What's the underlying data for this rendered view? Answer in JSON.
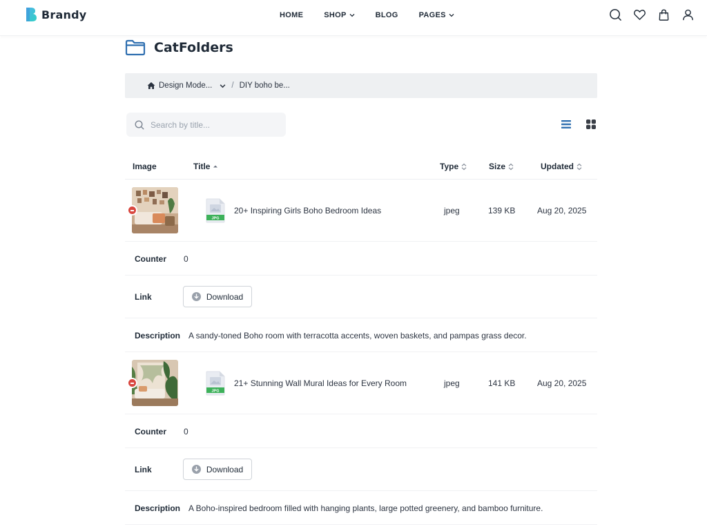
{
  "brand": {
    "name": "Brandy"
  },
  "nav": {
    "items": [
      {
        "label": "HOME",
        "has_dropdown": false
      },
      {
        "label": "SHOP",
        "has_dropdown": true
      },
      {
        "label": "BLOG",
        "has_dropdown": false
      },
      {
        "label": "PAGES",
        "has_dropdown": true
      }
    ]
  },
  "header_icons": [
    "search-icon",
    "heart-icon",
    "bag-icon",
    "user-icon"
  ],
  "page": {
    "title": "CatFolders"
  },
  "breadcrumb": {
    "items": [
      {
        "label": "Design Mode...",
        "icon": "home-icon",
        "has_dropdown": true
      },
      {
        "label": "DIY boho be..."
      }
    ],
    "separator": "/"
  },
  "search": {
    "placeholder": "Search by title...",
    "value": ""
  },
  "view": {
    "active": "list"
  },
  "table": {
    "columns": {
      "image": "Image",
      "title": "Title",
      "type": "Type",
      "size": "Size",
      "updated": "Updated"
    },
    "sort": {
      "column": "title",
      "direction": "asc"
    },
    "labels": {
      "counter": "Counter",
      "link": "Link",
      "description": "Description",
      "download": "Download"
    },
    "file_badge": "JPG",
    "rows": [
      {
        "title": "20+ Inspiring Girls Boho Bedroom Ideas",
        "type": "jpeg",
        "size": "139 KB",
        "updated": "Aug 20, 2025",
        "counter": "0",
        "description": "A sandy-toned Boho room with terracotta accents, woven baskets, and pampas grass decor."
      },
      {
        "title": "21+ Stunning Wall Mural Ideas for Every Room",
        "type": "jpeg",
        "size": "141 KB",
        "updated": "Aug 20, 2025",
        "counter": "0",
        "description": "A Boho-inspired bedroom filled with hanging plants, large potted greenery, and bamboo furniture."
      }
    ]
  },
  "colors": {
    "accent": "#2f6fb0",
    "remove": "#d9473f",
    "jpg_badge": "#3db15a",
    "breadcrumb_bg": "#eef0f2"
  }
}
